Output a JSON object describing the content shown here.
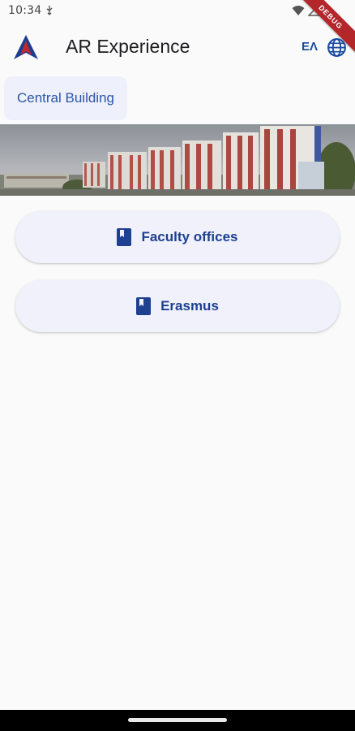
{
  "status_bar": {
    "time": "10:34",
    "debug_label": "DEBUG"
  },
  "app_bar": {
    "title": "AR Experience",
    "language_code": "EΛ",
    "logo_icon": "app-logo-icon",
    "globe_icon": "globe-icon"
  },
  "chip": {
    "label": "Central Building"
  },
  "banner": {
    "icon": "building-photo"
  },
  "buttons": [
    {
      "label": "Faculty offices",
      "icon": "book-icon"
    },
    {
      "label": "Erasmus",
      "icon": "book-icon"
    }
  ],
  "colors": {
    "accent": "#1a4ba0",
    "button_bg": "#f0f1fa",
    "chip_bg": "#eef0fb",
    "debug_ribbon": "#b3262a"
  }
}
